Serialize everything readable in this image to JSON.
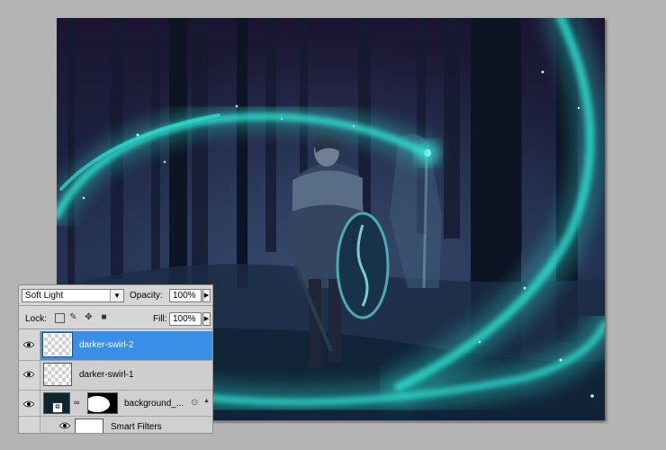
{
  "layers_panel": {
    "blend_mode": "Soft Light",
    "opacity_label": "Opacity:",
    "opacity_value": "100%",
    "lock_label": "Lock:",
    "fill_label": "Fill:",
    "fill_value": "100%",
    "layers": [
      {
        "name": "darker-swirl-2",
        "selected": true
      },
      {
        "name": "darker-swirl-1",
        "selected": false
      },
      {
        "name": "background_...",
        "selected": false
      }
    ],
    "smart_filters_label": "Smart Filters"
  },
  "colors": {
    "selection": "#3a8ee6",
    "swirl": "#2ee6d6",
    "workspace": "#b4b4b4"
  }
}
